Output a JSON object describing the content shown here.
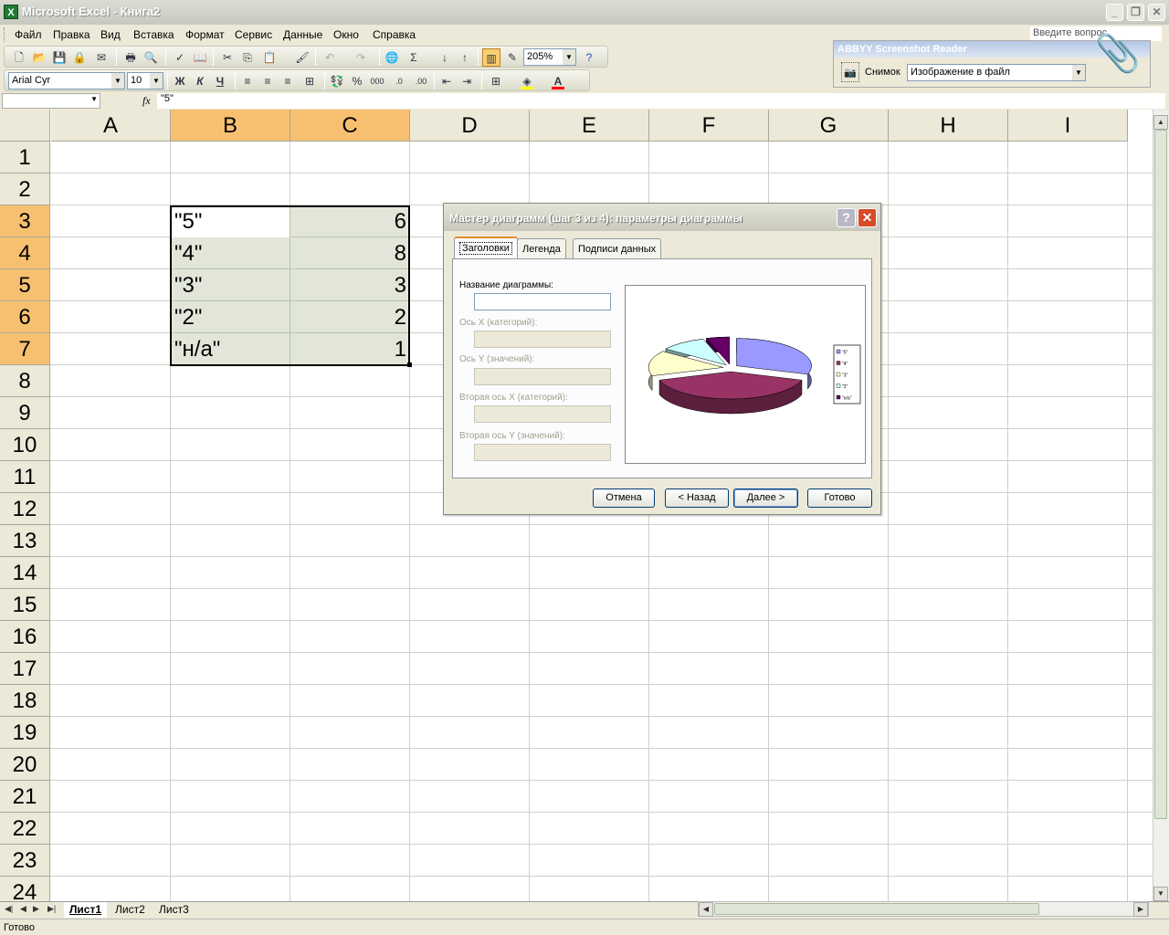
{
  "window": {
    "title": "Microsoft Excel - Книга2",
    "icon": "excel-icon"
  },
  "menu": {
    "items": [
      "Файл",
      "Правка",
      "Вид",
      "Вставка",
      "Формат",
      "Сервис",
      "Данные",
      "Окно",
      "Справка"
    ],
    "help_placeholder": "Введите вопрос"
  },
  "toolbar": {
    "zoom": "205%",
    "font_name": "Arial Cyr",
    "font_size": "10",
    "bold_label": "Ж",
    "italic_label": "К",
    "underline_label": "Ч",
    "percent_label": "%",
    "thousands_label": "000",
    "font_color": "#ff0000",
    "fill_color": "#ffff00"
  },
  "abbyy": {
    "title": "ABBYY Screenshot Reader",
    "snapshot_label": "Снимок",
    "mode_value": "Изображение в файл"
  },
  "formula_bar": {
    "fx": "fx",
    "content": "\"5\""
  },
  "grid": {
    "columns": [
      "A",
      "B",
      "C",
      "D",
      "E",
      "F",
      "G",
      "H",
      "I"
    ],
    "rows": [
      "1",
      "2",
      "3",
      "4",
      "5",
      "6",
      "7",
      "8",
      "9",
      "10",
      "11",
      "12",
      "13",
      "14",
      "15",
      "16",
      "17",
      "18",
      "19",
      "20",
      "21",
      "22",
      "23",
      "24"
    ],
    "data": [
      {
        "label": "\"5\"",
        "value": "6"
      },
      {
        "label": "\"4\"",
        "value": "8"
      },
      {
        "label": "\"3\"",
        "value": "3"
      },
      {
        "label": "\"2\"",
        "value": "2"
      },
      {
        "label": "\"н/а\"",
        "value": "1"
      }
    ]
  },
  "sheets": {
    "tabs": [
      "Лист1",
      "Лист2",
      "Лист3"
    ],
    "active": "Лист1"
  },
  "status": {
    "text": "Готово"
  },
  "dialog": {
    "title": "Мастер диаграмм (шаг 3 из 4): параметры диаграммы",
    "help_label": "?",
    "close_label": "✕",
    "tabs": [
      "Заголовки",
      "Легенда",
      "Подписи данных"
    ],
    "fields": {
      "chart_title": "Название диаграммы:",
      "x_axis": "Ось X (категорий):",
      "y_axis": "Ось Y (значений):",
      "x2_axis": "Вторая ось X (категорий):",
      "y2_axis": "Вторая ось Y (значений):"
    },
    "buttons": {
      "cancel": "Отмена",
      "back": "< Назад",
      "next": "Далее >",
      "finish": "Готово"
    }
  },
  "chart_data": {
    "type": "pie",
    "categories": [
      "\"5\"",
      "\"4\"",
      "\"3\"",
      "\"2\"",
      "\"н/а\""
    ],
    "values": [
      6,
      8,
      3,
      2,
      1
    ],
    "colors": [
      "#9999ff",
      "#993366",
      "#ffffcc",
      "#ccffff",
      "#660066"
    ],
    "legend": "right",
    "exploded": true,
    "three_d": true
  }
}
